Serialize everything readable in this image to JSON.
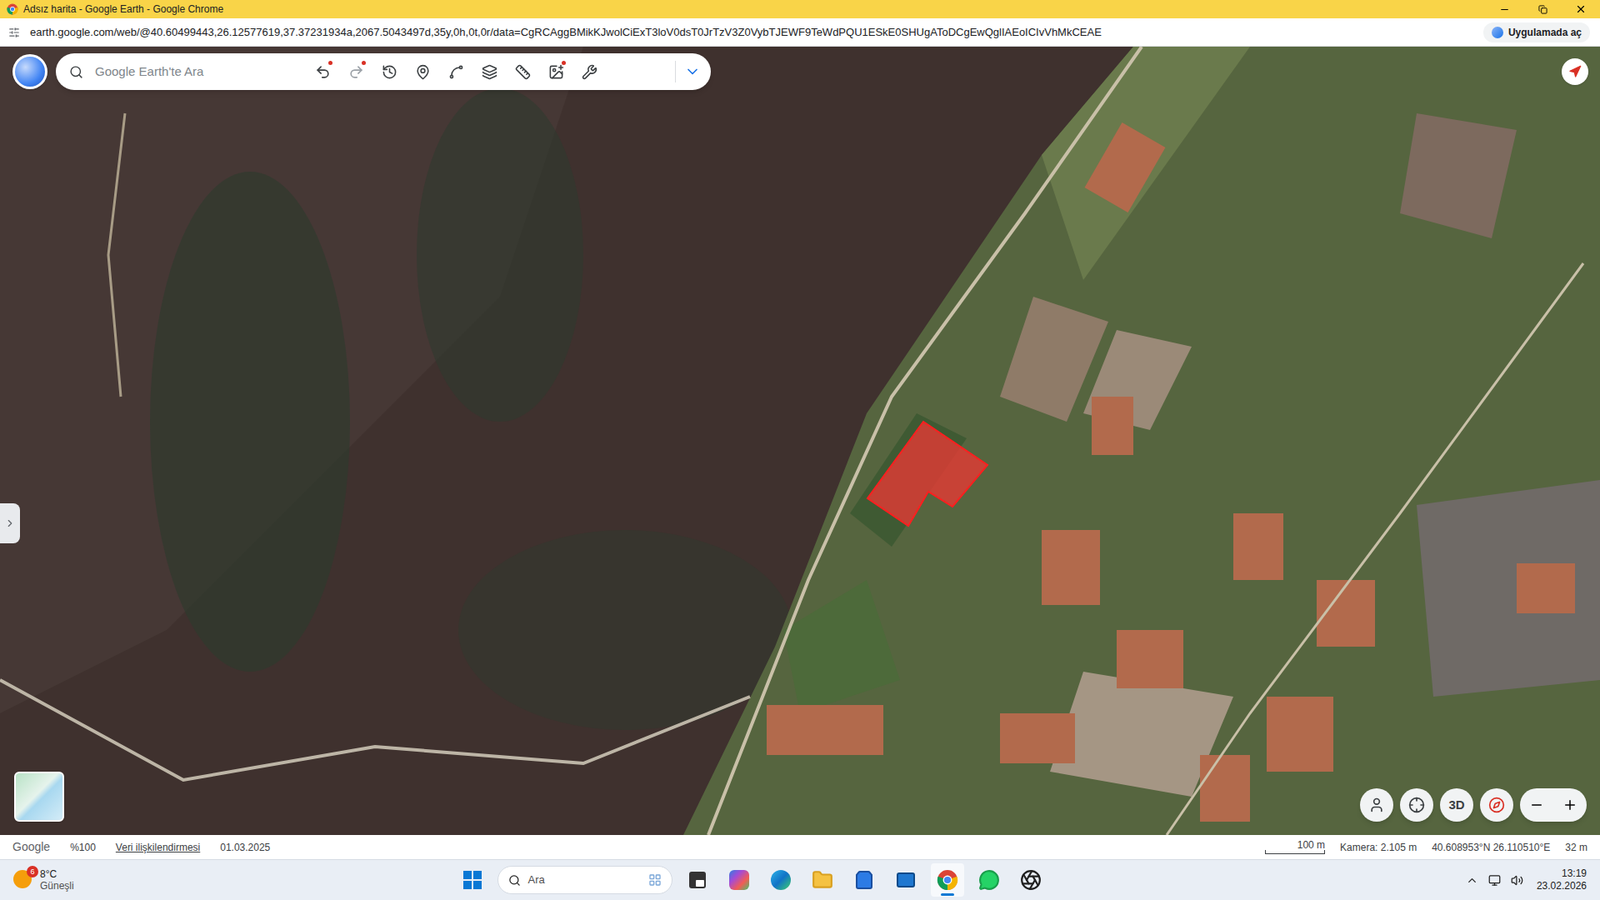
{
  "window": {
    "title": "Adsız harita - Google Earth - Google Chrome"
  },
  "address_bar": {
    "url": "earth.google.com/web/@40.60499443,26.12577619,37.37231934a,2067.5043497d,35y,0h,0t,0r/data=CgRCAggBMikKJwolCiExT3loV0dsT0JrTzV3Z0VybTJEWF9TeWdPQU1ESkE0SHUgAToDCgEwQglIAEoICIvVhMkCEAE",
    "open_in_app": "Uygulamada aç"
  },
  "toolbar": {
    "search_placeholder": "Google Earth'te Ara",
    "undo_enabled": true,
    "redo_enabled": false
  },
  "map": {
    "view_mode_button": "3D"
  },
  "status_bar": {
    "attribution": "Google",
    "zoom": "%100",
    "data_link": "Veri ilişkilendirmesi",
    "imagery_date": "01.03.2025",
    "scale": "100 m",
    "camera": "Kamera: 2.105 m",
    "coordinates": "40.608953°N 26.110510°E",
    "elevation": "32 m"
  },
  "taskbar": {
    "weather": {
      "badge": "6",
      "temperature": "8°C",
      "condition": "Güneşli"
    },
    "search_placeholder": "Ara",
    "apps": [
      {
        "kind": "taskview",
        "active": false
      },
      {
        "kind": "m365",
        "active": false
      },
      {
        "kind": "edge",
        "active": false
      },
      {
        "kind": "folder",
        "active": false
      },
      {
        "kind": "store",
        "active": false
      },
      {
        "kind": "outlook",
        "active": false
      },
      {
        "kind": "chrome",
        "active": true
      },
      {
        "kind": "whatsapp",
        "active": false
      },
      {
        "kind": "chatgpt",
        "active": false
      }
    ],
    "clock": {
      "time": "13:19",
      "date": "23.02.2026"
    }
  }
}
